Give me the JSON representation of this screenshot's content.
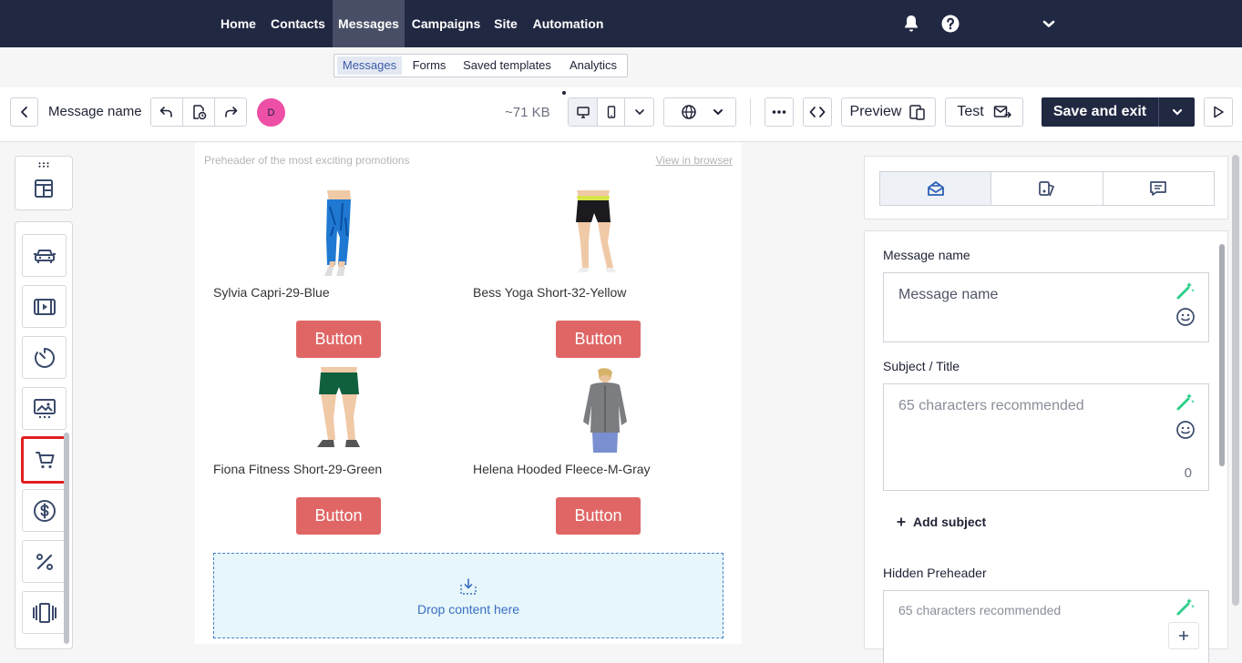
{
  "nav": {
    "items": [
      {
        "label": "Home"
      },
      {
        "label": "Contacts"
      },
      {
        "label": "Messages"
      },
      {
        "label": "Campaigns"
      },
      {
        "label": "Site"
      },
      {
        "label": "Automation"
      }
    ],
    "active": "Messages",
    "icons": [
      "bell-icon",
      "help-icon",
      "chevron-down-icon"
    ]
  },
  "subnav": {
    "items": [
      {
        "label": "Messages"
      },
      {
        "label": "Forms"
      },
      {
        "label": "Saved templates"
      },
      {
        "label": "Analytics"
      }
    ],
    "active": "Messages"
  },
  "toolbar": {
    "message_name": "Message name",
    "avatar_letter": "D",
    "size": "~71 KB",
    "preview_label": "Preview",
    "test_label": "Test",
    "save_label": "Save and exit"
  },
  "canvas": {
    "preheader": "Preheader of the most exciting promotions",
    "view_in_browser": "View in browser",
    "products": [
      {
        "name": "Sylvia Capri-29-Blue",
        "button": "Button"
      },
      {
        "name": "Bess Yoga Short-32-Yellow",
        "button": "Button"
      },
      {
        "name": "Fiona Fitness Short-29-Green",
        "button": "Button"
      },
      {
        "name": "Helena Hooded Fleece-M-Gray",
        "button": "Button"
      }
    ],
    "drop_text": "Drop content here"
  },
  "panel": {
    "message_name_label": "Message name",
    "message_name_placeholder": "Message name",
    "subject_label": "Subject / Title",
    "subject_placeholder": "65 characters recommended",
    "subject_count": "0",
    "add_subject": "Add subject",
    "preheader_label": "Hidden Preheader",
    "preheader_placeholder": "65 characters recommended"
  },
  "colors": {
    "nav_bg": "#212842",
    "button_red": "#e06666",
    "save_bg": "#212842",
    "avatar": "#ec4fa5",
    "highlight": "#e01e1e"
  }
}
